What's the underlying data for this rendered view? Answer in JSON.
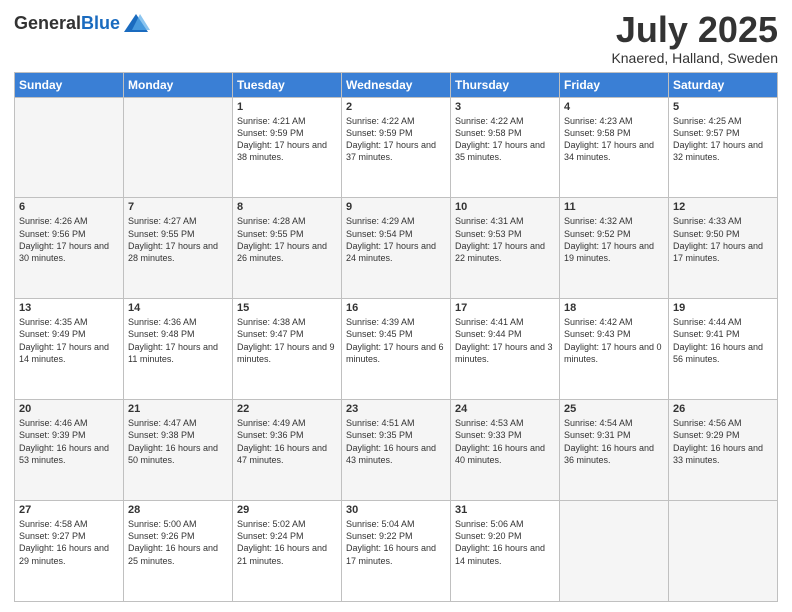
{
  "header": {
    "logo_general": "General",
    "logo_blue": "Blue",
    "month_title": "July 2025",
    "location": "Knaered, Halland, Sweden"
  },
  "days_of_week": [
    "Sunday",
    "Monday",
    "Tuesday",
    "Wednesday",
    "Thursday",
    "Friday",
    "Saturday"
  ],
  "weeks": [
    [
      {
        "day": "",
        "empty": true
      },
      {
        "day": "",
        "empty": true
      },
      {
        "day": "1",
        "sunrise": "Sunrise: 4:21 AM",
        "sunset": "Sunset: 9:59 PM",
        "daylight": "Daylight: 17 hours and 38 minutes."
      },
      {
        "day": "2",
        "sunrise": "Sunrise: 4:22 AM",
        "sunset": "Sunset: 9:59 PM",
        "daylight": "Daylight: 17 hours and 37 minutes."
      },
      {
        "day": "3",
        "sunrise": "Sunrise: 4:22 AM",
        "sunset": "Sunset: 9:58 PM",
        "daylight": "Daylight: 17 hours and 35 minutes."
      },
      {
        "day": "4",
        "sunrise": "Sunrise: 4:23 AM",
        "sunset": "Sunset: 9:58 PM",
        "daylight": "Daylight: 17 hours and 34 minutes."
      },
      {
        "day": "5",
        "sunrise": "Sunrise: 4:25 AM",
        "sunset": "Sunset: 9:57 PM",
        "daylight": "Daylight: 17 hours and 32 minutes."
      }
    ],
    [
      {
        "day": "6",
        "sunrise": "Sunrise: 4:26 AM",
        "sunset": "Sunset: 9:56 PM",
        "daylight": "Daylight: 17 hours and 30 minutes."
      },
      {
        "day": "7",
        "sunrise": "Sunrise: 4:27 AM",
        "sunset": "Sunset: 9:55 PM",
        "daylight": "Daylight: 17 hours and 28 minutes."
      },
      {
        "day": "8",
        "sunrise": "Sunrise: 4:28 AM",
        "sunset": "Sunset: 9:55 PM",
        "daylight": "Daylight: 17 hours and 26 minutes."
      },
      {
        "day": "9",
        "sunrise": "Sunrise: 4:29 AM",
        "sunset": "Sunset: 9:54 PM",
        "daylight": "Daylight: 17 hours and 24 minutes."
      },
      {
        "day": "10",
        "sunrise": "Sunrise: 4:31 AM",
        "sunset": "Sunset: 9:53 PM",
        "daylight": "Daylight: 17 hours and 22 minutes."
      },
      {
        "day": "11",
        "sunrise": "Sunrise: 4:32 AM",
        "sunset": "Sunset: 9:52 PM",
        "daylight": "Daylight: 17 hours and 19 minutes."
      },
      {
        "day": "12",
        "sunrise": "Sunrise: 4:33 AM",
        "sunset": "Sunset: 9:50 PM",
        "daylight": "Daylight: 17 hours and 17 minutes."
      }
    ],
    [
      {
        "day": "13",
        "sunrise": "Sunrise: 4:35 AM",
        "sunset": "Sunset: 9:49 PM",
        "daylight": "Daylight: 17 hours and 14 minutes."
      },
      {
        "day": "14",
        "sunrise": "Sunrise: 4:36 AM",
        "sunset": "Sunset: 9:48 PM",
        "daylight": "Daylight: 17 hours and 11 minutes."
      },
      {
        "day": "15",
        "sunrise": "Sunrise: 4:38 AM",
        "sunset": "Sunset: 9:47 PM",
        "daylight": "Daylight: 17 hours and 9 minutes."
      },
      {
        "day": "16",
        "sunrise": "Sunrise: 4:39 AM",
        "sunset": "Sunset: 9:45 PM",
        "daylight": "Daylight: 17 hours and 6 minutes."
      },
      {
        "day": "17",
        "sunrise": "Sunrise: 4:41 AM",
        "sunset": "Sunset: 9:44 PM",
        "daylight": "Daylight: 17 hours and 3 minutes."
      },
      {
        "day": "18",
        "sunrise": "Sunrise: 4:42 AM",
        "sunset": "Sunset: 9:43 PM",
        "daylight": "Daylight: 17 hours and 0 minutes."
      },
      {
        "day": "19",
        "sunrise": "Sunrise: 4:44 AM",
        "sunset": "Sunset: 9:41 PM",
        "daylight": "Daylight: 16 hours and 56 minutes."
      }
    ],
    [
      {
        "day": "20",
        "sunrise": "Sunrise: 4:46 AM",
        "sunset": "Sunset: 9:39 PM",
        "daylight": "Daylight: 16 hours and 53 minutes."
      },
      {
        "day": "21",
        "sunrise": "Sunrise: 4:47 AM",
        "sunset": "Sunset: 9:38 PM",
        "daylight": "Daylight: 16 hours and 50 minutes."
      },
      {
        "day": "22",
        "sunrise": "Sunrise: 4:49 AM",
        "sunset": "Sunset: 9:36 PM",
        "daylight": "Daylight: 16 hours and 47 minutes."
      },
      {
        "day": "23",
        "sunrise": "Sunrise: 4:51 AM",
        "sunset": "Sunset: 9:35 PM",
        "daylight": "Daylight: 16 hours and 43 minutes."
      },
      {
        "day": "24",
        "sunrise": "Sunrise: 4:53 AM",
        "sunset": "Sunset: 9:33 PM",
        "daylight": "Daylight: 16 hours and 40 minutes."
      },
      {
        "day": "25",
        "sunrise": "Sunrise: 4:54 AM",
        "sunset": "Sunset: 9:31 PM",
        "daylight": "Daylight: 16 hours and 36 minutes."
      },
      {
        "day": "26",
        "sunrise": "Sunrise: 4:56 AM",
        "sunset": "Sunset: 9:29 PM",
        "daylight": "Daylight: 16 hours and 33 minutes."
      }
    ],
    [
      {
        "day": "27",
        "sunrise": "Sunrise: 4:58 AM",
        "sunset": "Sunset: 9:27 PM",
        "daylight": "Daylight: 16 hours and 29 minutes."
      },
      {
        "day": "28",
        "sunrise": "Sunrise: 5:00 AM",
        "sunset": "Sunset: 9:26 PM",
        "daylight": "Daylight: 16 hours and 25 minutes."
      },
      {
        "day": "29",
        "sunrise": "Sunrise: 5:02 AM",
        "sunset": "Sunset: 9:24 PM",
        "daylight": "Daylight: 16 hours and 21 minutes."
      },
      {
        "day": "30",
        "sunrise": "Sunrise: 5:04 AM",
        "sunset": "Sunset: 9:22 PM",
        "daylight": "Daylight: 16 hours and 17 minutes."
      },
      {
        "day": "31",
        "sunrise": "Sunrise: 5:06 AM",
        "sunset": "Sunset: 9:20 PM",
        "daylight": "Daylight: 16 hours and 14 minutes."
      },
      {
        "day": "",
        "empty": true
      },
      {
        "day": "",
        "empty": true
      }
    ]
  ]
}
